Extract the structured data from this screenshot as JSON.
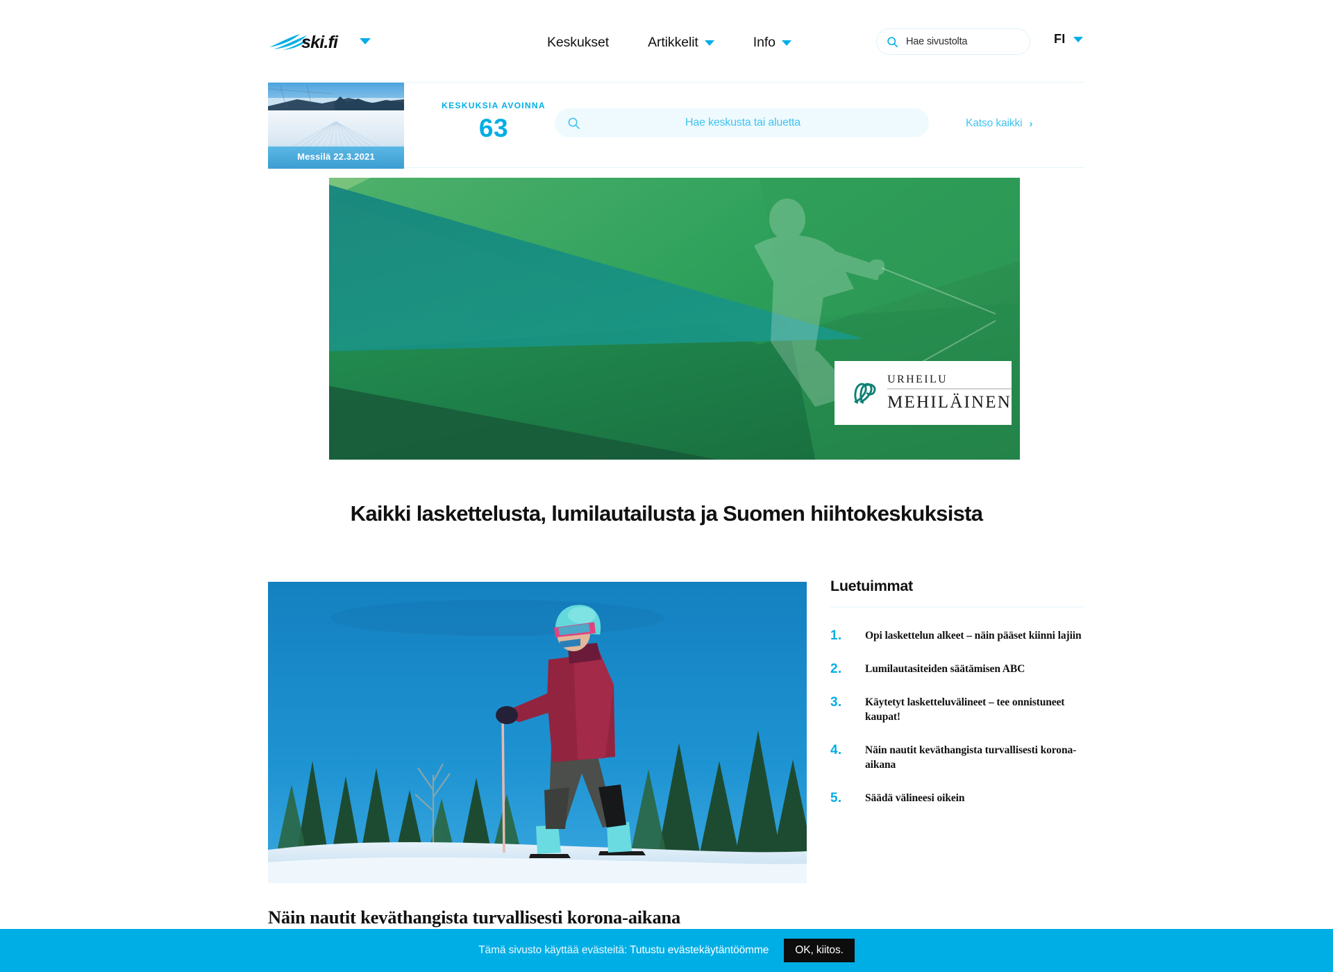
{
  "header": {
    "logo_text": "ski.fi",
    "logo_caret_icon": "chevron-down-icon",
    "nav": [
      {
        "label": "Keskukset",
        "has_caret": false
      },
      {
        "label": "Artikkelit",
        "has_caret": true
      },
      {
        "label": "Info",
        "has_caret": true
      }
    ],
    "search": {
      "icon": "search-icon",
      "placeholder": "Hae sivustolta",
      "value": ""
    },
    "language": {
      "label": "FI",
      "caret_icon": "chevron-down-icon"
    }
  },
  "resorts_bar": {
    "thumbnail_caption": "Messilä 22.3.2021",
    "counter_label": "KESKUKSIA AVOINNA",
    "counter_value": "63",
    "search": {
      "icon": "search-icon",
      "placeholder": "Hae keskusta tai aluetta",
      "value": ""
    },
    "see_all_label": "Katso kaikki",
    "see_all_chevron": "›"
  },
  "ad": {
    "advertiser_top": "URHEILU",
    "advertiser_bottom": "MEHILÄINEN"
  },
  "page_heading": "Kaikki laskettelusta, lumilautailusta ja Suomen hiihtokeskuksista",
  "article": {
    "title": "Näin nautit keväthangista turvallisesti korona-aikana"
  },
  "sidebar": {
    "heading": "Luetuimmat",
    "items": [
      {
        "num": "1.",
        "text": "Opi laskettelun alkeet – näin pääset kiinni lajiin"
      },
      {
        "num": "2.",
        "text": "Lumilautasiteiden säätämisen ABC"
      },
      {
        "num": "3.",
        "text": "Käytetyt lasketteluvälineet – tee onnistuneet kaupat!"
      },
      {
        "num": "4.",
        "text": "Näin nautit keväthangista turvallisesti korona-aikana"
      },
      {
        "num": "5.",
        "text": "Säädä välineesi oikein"
      }
    ]
  },
  "cookie": {
    "text_prefix": "Tämä sivusto käyttää evästeitä: ",
    "link_text": "Tutustu evästekäytäntöömme",
    "button_label": "OK, kiitos."
  },
  "colors": {
    "brand_blue": "#00AEE6",
    "light_blue": "#3FC3F0",
    "pale_blue_bg": "#EFFAFE",
    "divider": "#E4F4FB",
    "ad_green": "#2E9B4E",
    "ad_teal": "#1C8C85",
    "mehilainen_teal": "#0E8074"
  }
}
